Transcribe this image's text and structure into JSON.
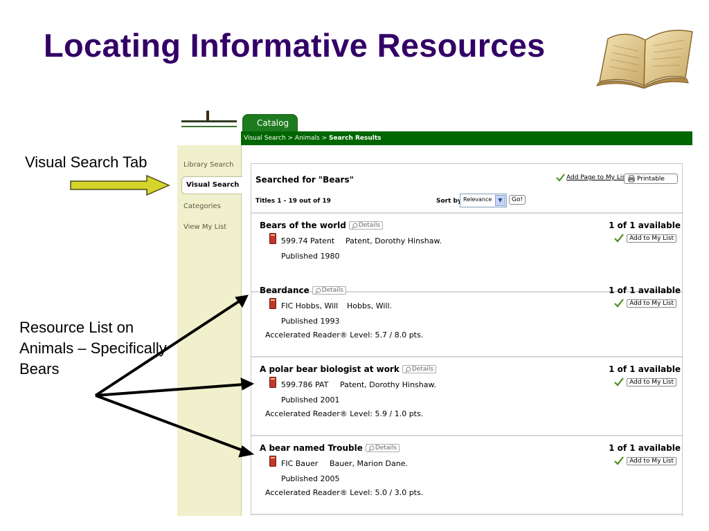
{
  "slide": {
    "title": "Locating Informative Resources",
    "annotation_visual_tab": "Visual Search Tab",
    "annotation_resource_list": "Resource List on Animals – Specifically Bears"
  },
  "app": {
    "tab_catalog": "Catalog",
    "breadcrumb_prefix": "Visual Search > Animals > ",
    "breadcrumb_current": "Search Results",
    "sidebar": {
      "items": [
        "Library Search",
        "Visual Search",
        "Categories",
        "View My List"
      ],
      "active": "Visual Search"
    },
    "search": {
      "searched_for": "Searched for \"Bears\"",
      "titles_count": "Titles 1 - 19 out of 19",
      "sort_label": "Sort by",
      "sort_value": "Relevance",
      "go_label": "Go!",
      "add_page_label": "Add Page to My List",
      "printable_label": "Printable"
    },
    "details_label": "Details",
    "add_to_list_label": "Add to My List",
    "results": [
      {
        "title": "Bears of the world",
        "call_number": "599.74 Patent",
        "author": "Patent, Dorothy Hinshaw.",
        "published": "Published 1980",
        "ar_level": "",
        "availability": "1 of 1 available"
      },
      {
        "title": "Beardance",
        "call_number": "FIC Hobbs, Will",
        "author": "Hobbs, Will.",
        "published": "Published 1993",
        "ar_level": "Accelerated Reader® Level:  5.7 / 8.0 pts.",
        "availability": "1 of 1 available"
      },
      {
        "title": "A polar bear biologist at work",
        "call_number": "599.786 PAT",
        "author": "Patent, Dorothy Hinshaw.",
        "published": "Published 2001",
        "ar_level": "Accelerated Reader® Level:  5.9 / 1.0 pts.",
        "availability": "1 of 1 available"
      },
      {
        "title": "A bear named Trouble",
        "call_number": "FIC Bauer",
        "author": "Bauer, Marion Dane.",
        "published": "Published 2005",
        "ar_level": "Accelerated Reader® Level:  5.0 / 3.0 pts.",
        "availability": "1 of 1 available"
      }
    ]
  },
  "colors": {
    "title": "#330066",
    "green_bar": "#006600",
    "sidebar": "#f0f0cc",
    "yellow_arrow": "#d4d42a"
  },
  "icons": [
    "open-book-icon",
    "yellow-arrow-icon",
    "black-arrow-icon",
    "red-book-icon",
    "magnifier-icon",
    "checkmark-icon",
    "printer-icon"
  ]
}
